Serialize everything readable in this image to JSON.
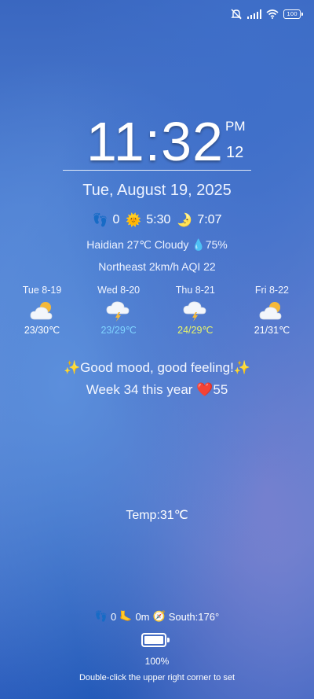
{
  "status": {
    "battery": "100",
    "icons": [
      "mute-icon",
      "signal-icon",
      "wifi-icon",
      "battery-icon"
    ]
  },
  "clock": {
    "time": "11:32",
    "ampm": "PM",
    "seconds": "12"
  },
  "date": "Tue, August 19, 2025",
  "summary": {
    "steps_emoji": "👣",
    "steps": "0",
    "sunrise_emoji": "🌞",
    "sunrise": "5:30",
    "sunset_emoji": "🌛",
    "sunset": "7:07"
  },
  "weather": {
    "line1_prefix": "Haidian 27℃ Cloudy ",
    "humidity_emoji": "💧",
    "humidity": "75%",
    "line2": "Northeast 2km/h AQI 22"
  },
  "forecast": [
    {
      "day": "Tue 8-19",
      "icon": "partly-cloudy-icon",
      "temp": "23/30℃",
      "color": "#ffffff"
    },
    {
      "day": "Wed 8-20",
      "icon": "thunderstorm-icon",
      "temp": "23/29℃",
      "color": "#7fd3ff"
    },
    {
      "day": "Thu 8-21",
      "icon": "thunderstorm-icon",
      "temp": "24/29℃",
      "color": "#e8f56a"
    },
    {
      "day": "Fri 8-22",
      "icon": "partly-cloudy-icon",
      "temp": "21/31℃",
      "color": "#ffffff"
    }
  ],
  "mood": {
    "sparkle": "✨",
    "text": "Good mood, good feeling!"
  },
  "week": {
    "text": "Week 34 this year ",
    "heart": "❤️",
    "count": "55"
  },
  "temperature": "Temp:31℃",
  "bottom": {
    "steps_emoji": "👣",
    "steps": "0",
    "altitude_emoji": "🦶",
    "altitude": "0m",
    "compass_emoji": "🧭",
    "direction": "South:176°"
  },
  "battery": {
    "level": 1.0,
    "percent": "100%"
  },
  "hint": "Double-click the upper right corner to set"
}
